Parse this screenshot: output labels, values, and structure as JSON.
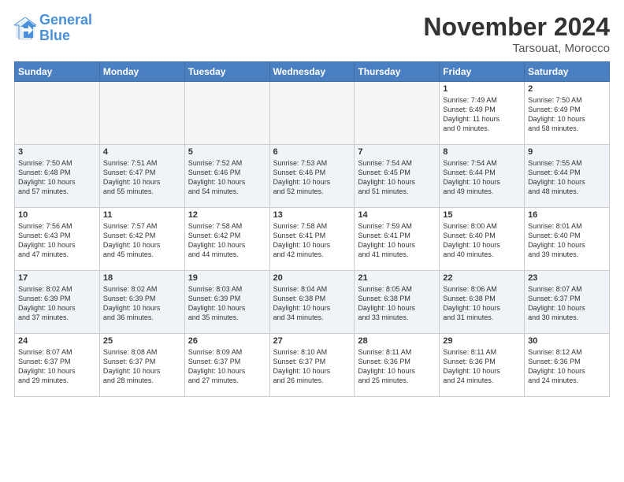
{
  "logo": {
    "line1": "General",
    "line2": "Blue"
  },
  "title": "November 2024",
  "location": "Tarsouat, Morocco",
  "weekdays": [
    "Sunday",
    "Monday",
    "Tuesday",
    "Wednesday",
    "Thursday",
    "Friday",
    "Saturday"
  ],
  "weeks": [
    [
      {
        "day": "",
        "info": ""
      },
      {
        "day": "",
        "info": ""
      },
      {
        "day": "",
        "info": ""
      },
      {
        "day": "",
        "info": ""
      },
      {
        "day": "",
        "info": ""
      },
      {
        "day": "1",
        "info": "Sunrise: 7:49 AM\nSunset: 6:49 PM\nDaylight: 11 hours\nand 0 minutes."
      },
      {
        "day": "2",
        "info": "Sunrise: 7:50 AM\nSunset: 6:49 PM\nDaylight: 10 hours\nand 58 minutes."
      }
    ],
    [
      {
        "day": "3",
        "info": "Sunrise: 7:50 AM\nSunset: 6:48 PM\nDaylight: 10 hours\nand 57 minutes."
      },
      {
        "day": "4",
        "info": "Sunrise: 7:51 AM\nSunset: 6:47 PM\nDaylight: 10 hours\nand 55 minutes."
      },
      {
        "day": "5",
        "info": "Sunrise: 7:52 AM\nSunset: 6:46 PM\nDaylight: 10 hours\nand 54 minutes."
      },
      {
        "day": "6",
        "info": "Sunrise: 7:53 AM\nSunset: 6:46 PM\nDaylight: 10 hours\nand 52 minutes."
      },
      {
        "day": "7",
        "info": "Sunrise: 7:54 AM\nSunset: 6:45 PM\nDaylight: 10 hours\nand 51 minutes."
      },
      {
        "day": "8",
        "info": "Sunrise: 7:54 AM\nSunset: 6:44 PM\nDaylight: 10 hours\nand 49 minutes."
      },
      {
        "day": "9",
        "info": "Sunrise: 7:55 AM\nSunset: 6:44 PM\nDaylight: 10 hours\nand 48 minutes."
      }
    ],
    [
      {
        "day": "10",
        "info": "Sunrise: 7:56 AM\nSunset: 6:43 PM\nDaylight: 10 hours\nand 47 minutes."
      },
      {
        "day": "11",
        "info": "Sunrise: 7:57 AM\nSunset: 6:42 PM\nDaylight: 10 hours\nand 45 minutes."
      },
      {
        "day": "12",
        "info": "Sunrise: 7:58 AM\nSunset: 6:42 PM\nDaylight: 10 hours\nand 44 minutes."
      },
      {
        "day": "13",
        "info": "Sunrise: 7:58 AM\nSunset: 6:41 PM\nDaylight: 10 hours\nand 42 minutes."
      },
      {
        "day": "14",
        "info": "Sunrise: 7:59 AM\nSunset: 6:41 PM\nDaylight: 10 hours\nand 41 minutes."
      },
      {
        "day": "15",
        "info": "Sunrise: 8:00 AM\nSunset: 6:40 PM\nDaylight: 10 hours\nand 40 minutes."
      },
      {
        "day": "16",
        "info": "Sunrise: 8:01 AM\nSunset: 6:40 PM\nDaylight: 10 hours\nand 39 minutes."
      }
    ],
    [
      {
        "day": "17",
        "info": "Sunrise: 8:02 AM\nSunset: 6:39 PM\nDaylight: 10 hours\nand 37 minutes."
      },
      {
        "day": "18",
        "info": "Sunrise: 8:02 AM\nSunset: 6:39 PM\nDaylight: 10 hours\nand 36 minutes."
      },
      {
        "day": "19",
        "info": "Sunrise: 8:03 AM\nSunset: 6:39 PM\nDaylight: 10 hours\nand 35 minutes."
      },
      {
        "day": "20",
        "info": "Sunrise: 8:04 AM\nSunset: 6:38 PM\nDaylight: 10 hours\nand 34 minutes."
      },
      {
        "day": "21",
        "info": "Sunrise: 8:05 AM\nSunset: 6:38 PM\nDaylight: 10 hours\nand 33 minutes."
      },
      {
        "day": "22",
        "info": "Sunrise: 8:06 AM\nSunset: 6:38 PM\nDaylight: 10 hours\nand 31 minutes."
      },
      {
        "day": "23",
        "info": "Sunrise: 8:07 AM\nSunset: 6:37 PM\nDaylight: 10 hours\nand 30 minutes."
      }
    ],
    [
      {
        "day": "24",
        "info": "Sunrise: 8:07 AM\nSunset: 6:37 PM\nDaylight: 10 hours\nand 29 minutes."
      },
      {
        "day": "25",
        "info": "Sunrise: 8:08 AM\nSunset: 6:37 PM\nDaylight: 10 hours\nand 28 minutes."
      },
      {
        "day": "26",
        "info": "Sunrise: 8:09 AM\nSunset: 6:37 PM\nDaylight: 10 hours\nand 27 minutes."
      },
      {
        "day": "27",
        "info": "Sunrise: 8:10 AM\nSunset: 6:37 PM\nDaylight: 10 hours\nand 26 minutes."
      },
      {
        "day": "28",
        "info": "Sunrise: 8:11 AM\nSunset: 6:36 PM\nDaylight: 10 hours\nand 25 minutes."
      },
      {
        "day": "29",
        "info": "Sunrise: 8:11 AM\nSunset: 6:36 PM\nDaylight: 10 hours\nand 24 minutes."
      },
      {
        "day": "30",
        "info": "Sunrise: 8:12 AM\nSunset: 6:36 PM\nDaylight: 10 hours\nand 24 minutes."
      }
    ]
  ]
}
